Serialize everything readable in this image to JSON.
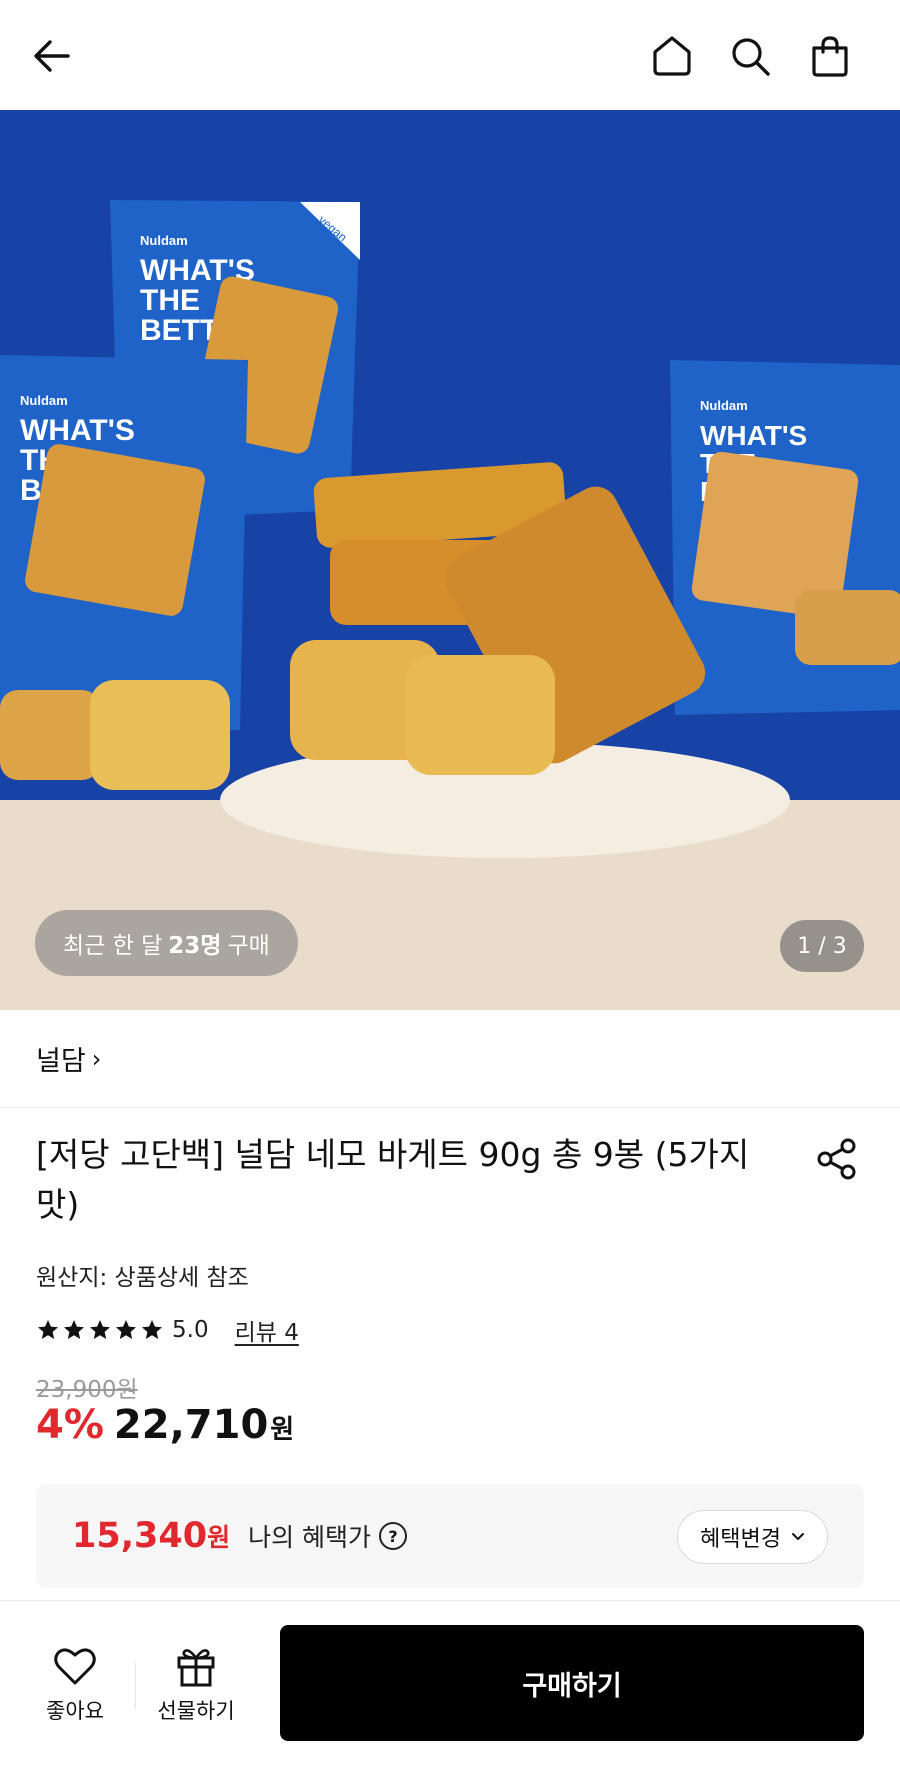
{
  "header": {
    "back_icon": "arrow-left-icon",
    "home_icon": "home-icon",
    "search_icon": "search-icon",
    "bag_icon": "shopping-bag-icon"
  },
  "hero": {
    "recent_prefix": "최근 한 달",
    "recent_count": "23명",
    "recent_suffix": "구매",
    "page_indicator": "1 / 3",
    "package_brand": "Nuldam",
    "package_text_1": "WHAT'S",
    "package_text_2": "THE",
    "package_text_3": "BETTER?",
    "package_tag": "vegan",
    "colors": {
      "background": "#1742a6",
      "table": "#e9dccb"
    }
  },
  "brand": {
    "name": "널담",
    "chevron": "›"
  },
  "product": {
    "title": "[저당 고단백] 널담 네모 바게트 90g 총 9봉 (5가지맛)",
    "origin": "원산지: 상품상세 참조",
    "rating": "5.0",
    "rating_stars": 5,
    "review_link": "리뷰 4",
    "original_price": "23,900원",
    "discount": "4%",
    "price": "22,710",
    "price_unit": "원"
  },
  "benefit": {
    "price": "15,340",
    "unit": "원",
    "label": "나의 혜택가",
    "help": "?",
    "change_button": "혜택변경"
  },
  "bottom_bar": {
    "like_label": "좋아요",
    "gift_label": "선물하기",
    "buy_label": "구매하기"
  },
  "colors": {
    "accent_red": "#e0282e",
    "buy_button": "#000000"
  }
}
